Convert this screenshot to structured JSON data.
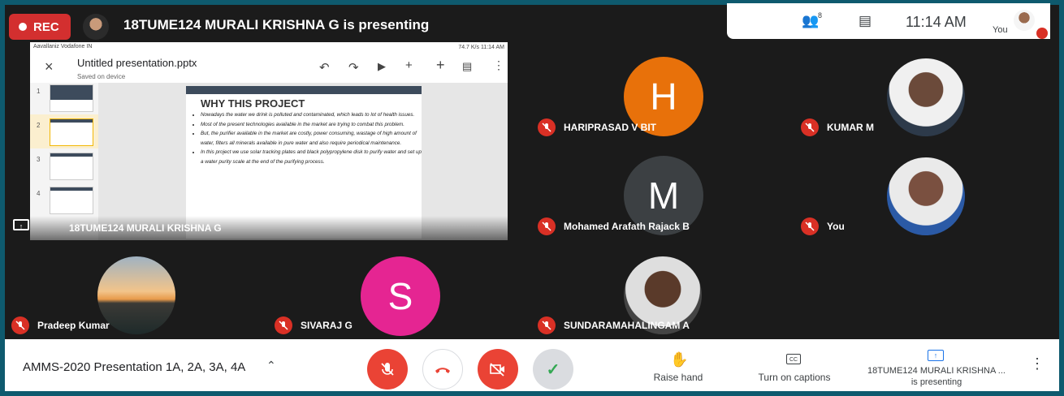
{
  "top": {
    "rec_label": "REC",
    "presenting_title": "18TUME124 MURALI KRISHNA G is presenting",
    "participants_count": "8",
    "time": "11:14 AM",
    "you_label": "You"
  },
  "screen": {
    "status_left": "Aavallaniz Vodafone IN",
    "status_right": "74.7 K/s   11:14 AM",
    "doc_title": "Untitled presentation.pptx",
    "doc_sub": "Saved on device",
    "slide_numbers": [
      "1",
      "2",
      "3",
      "4"
    ],
    "slide_title": "WHY THIS PROJECT",
    "bullets": [
      "Nowadays the water we drink is polluted and contaminated, which leads to lot of health issues.",
      "Most of the present technologies available in the market are trying to combat this problem.",
      "But, the purifier available in the market are costly, power consuming, wastage of high amount of water, filters all minerals available in pure water and also require periodical maintenance.",
      "In this project we use solar tracking plates and black polypropylene disk to purify water and set up a water purity scale at the end of the purifying process."
    ],
    "presenter_name": "18TUME124 MURALI KRISHNA G"
  },
  "participants": {
    "hariprasad": {
      "name": "HARIPRASAD V BIT",
      "initial": "H",
      "color": "#e8710a"
    },
    "kumar": {
      "name": "KUMAR M"
    },
    "mohamed": {
      "name": "Mohamed Arafath Rajack B",
      "initial": "M",
      "color": "#3c4043"
    },
    "you": {
      "name": "You"
    },
    "pradeep": {
      "name": "Pradeep Kumar"
    },
    "sivaraj": {
      "name": "SIVARAJ G",
      "initial": "S",
      "color": "#e52592"
    },
    "sundaram": {
      "name": "SUNDARAMAHALINGAM A"
    }
  },
  "bottom": {
    "meeting_name": "AMMS-2020 Presentation 1A, 2A, 3A, 4A",
    "raise_hand": "Raise hand",
    "captions": "Turn on captions",
    "presenting_line1": "18TUME124 MURALI KRISHNA ...",
    "presenting_line2": "is presenting"
  }
}
